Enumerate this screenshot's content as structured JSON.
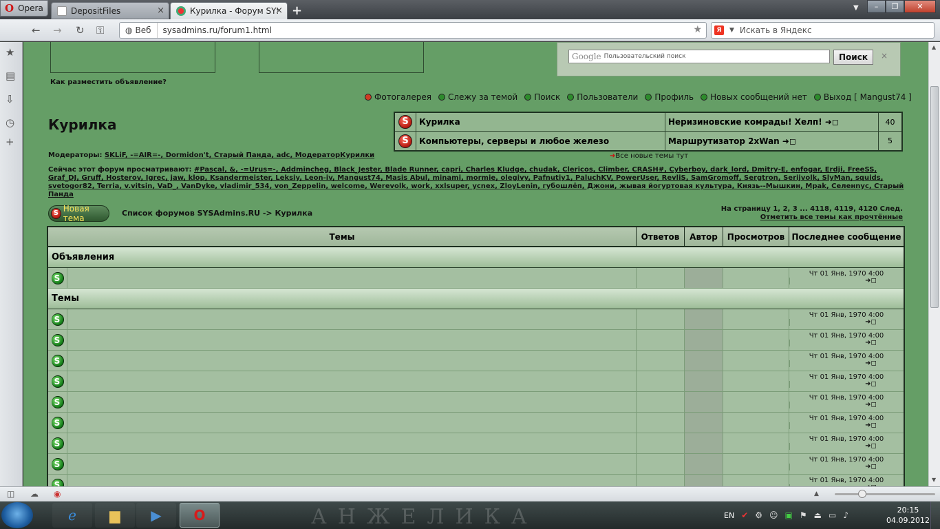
{
  "browser": {
    "menu_label": "Opera",
    "tabs": [
      {
        "title": "DepositFiles"
      },
      {
        "title": "Курилка - Форум SYS..."
      }
    ],
    "address": {
      "scheme_label": "Веб",
      "url": "sysadmins.ru/forum1.html"
    },
    "search_placeholder": "Искать в Яндекс",
    "search_engine_badge": "Я"
  },
  "page": {
    "google": {
      "placeholder": "Пользовательский поиск",
      "brand": "Google",
      "button": "Поиск",
      "close": "×"
    },
    "how_to_advertise": "Как разместить объявление?",
    "topnav": [
      {
        "label": "Фотогалерея",
        "color": "#cf3b23"
      },
      {
        "label": "Слежу за темой",
        "color": "#2d8b2c"
      },
      {
        "label": "Поиск",
        "color": "#2d8b2c"
      },
      {
        "label": "Пользователи",
        "color": "#2d8b2c"
      },
      {
        "label": "Профиль",
        "color": "#2d8b2c"
      },
      {
        "label": "Новых сообщений нет",
        "color": "#2d8b2c"
      },
      {
        "label": "Выход [ Mangust74 ]",
        "color": "#2d8b2c"
      }
    ],
    "forum_title": "Курилка",
    "subforums": [
      {
        "name": "Курилка",
        "last": "Неризиновские комрады! Хелп! ➜◻",
        "count": "40"
      },
      {
        "name": "Компьютеры, серверы и любое железо",
        "last": "Маршрутизатор 2xWan ➜◻",
        "count": "5"
      }
    ],
    "new_topics_link": "Все новые темы тут",
    "moderators_label": "Модераторы:",
    "moderators": "SKLiF, -=AIR=-, Dormidon't, Старый Панда, adc, МодераторКурилки",
    "viewing_label": "Сейчас этот форум просматривают:",
    "viewing_users": "#Pascal, &, -=Urus=-, Addmincheg, Black_Jester, Blade Runner, capri, Charles Kludge, chudak, Clericos, Climber, CRASH#, Cyberboy, dark_lord, Dmitry-E, enfogar, Erdji, FreeSS, Graf_DJ, Gruff, Hosterov, Igrec, jaw, klop, Ksandermeister, Leksiy, Leon-iv, Mangust74, Masis Abul, minami, mormie, olegivy, Pafnutiy1, PaluchKV, PowerUser, RevliS, SamGromoff, Sergtron, Serijvolk, SlyMan, squids, svetogor82, Terria, v.vitsin, VaD_, VanDyke, vladimir_534, von_Zeppelin, welcome, Werevolk, work, xxlsuper, ycnex, ZloyLenin, губошлёп, Джони, жывая йогуртовая культура, Князь--Мышкин, Mpak, Селенnус, Старый Панда",
    "new_topic_button": "Новая тема",
    "breadcrumb": "Список форумов SYSAdmins.RU -> Курилка",
    "pagination": "На страницу 1, 2, 3 ... 4118, 4119, 4120  След.",
    "mark_read": "Отметить все темы как прочтённые",
    "table": {
      "headers": [
        "Темы",
        "Ответов",
        "Автор",
        "Просмотров",
        "Последнее сообщение"
      ],
      "sections": [
        {
          "title": "Объявления",
          "rows": [
            {
              "last": "Чт 01 Янв, 1970 4:00"
            }
          ]
        },
        {
          "title": "Темы",
          "rows": [
            {
              "last": "Чт 01 Янв, 1970 4:00"
            },
            {
              "last": "Чт 01 Янв, 1970 4:00"
            },
            {
              "last": "Чт 01 Янв, 1970 4:00"
            },
            {
              "last": "Чт 01 Янв, 1970 4:00"
            },
            {
              "last": "Чт 01 Янв, 1970 4:00"
            },
            {
              "last": "Чт 01 Янв, 1970 4:00"
            },
            {
              "last": "Чт 01 Янв, 1970 4:00"
            },
            {
              "last": "Чт 01 Янв, 1970 4:00"
            },
            {
              "last": "Чт 01 Янв, 1970 4:00"
            }
          ]
        }
      ]
    }
  },
  "taskbar": {
    "watermark": "АНЖЕЛИКА",
    "lang": "EN",
    "time": "20:15",
    "date": "04.09.2012"
  }
}
